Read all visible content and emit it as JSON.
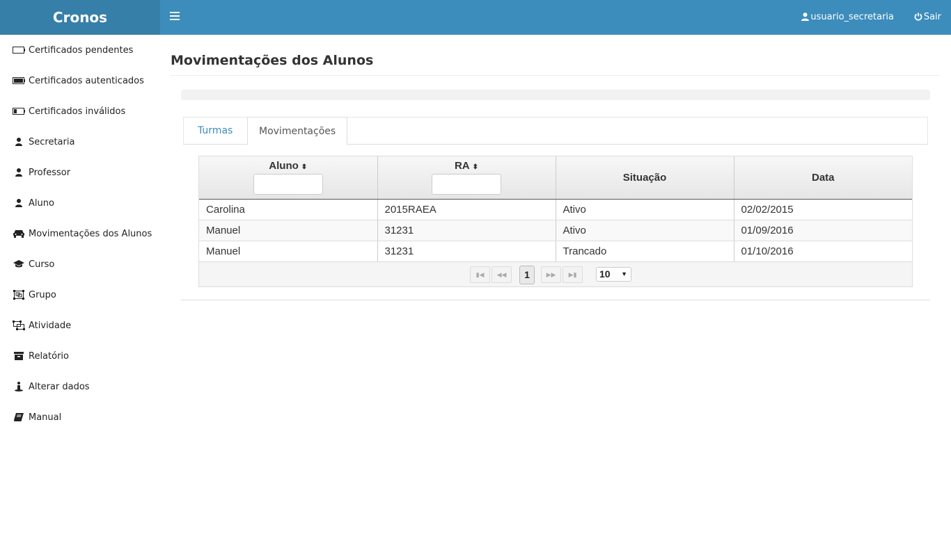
{
  "brand": "Cronos",
  "topbar": {
    "user": "usuario_secretaria",
    "logout": "Sair"
  },
  "sidebar": {
    "items": [
      {
        "label": "Certificados pendentes",
        "icon": "battery-empty-icon"
      },
      {
        "label": "Certificados autenticados",
        "icon": "battery-full-icon"
      },
      {
        "label": "Certificados inválidos",
        "icon": "battery-quarter-icon"
      },
      {
        "label": "Secretaria",
        "icon": "user-icon"
      },
      {
        "label": "Professor",
        "icon": "user-icon"
      },
      {
        "label": "Aluno",
        "icon": "user-icon"
      },
      {
        "label": "Movimentações dos Alunos",
        "icon": "car-icon"
      },
      {
        "label": "Curso",
        "icon": "graduation-cap-icon"
      },
      {
        "label": "Grupo",
        "icon": "object-group-icon"
      },
      {
        "label": "Atividade",
        "icon": "object-ungroup-icon"
      },
      {
        "label": "Relatório",
        "icon": "archive-icon"
      },
      {
        "label": "Alterar dados",
        "icon": "street-view-icon"
      },
      {
        "label": "Manual",
        "icon": "book-icon"
      }
    ]
  },
  "page": {
    "title": "Movimentações dos Alunos"
  },
  "tabs": [
    {
      "label": "Turmas"
    },
    {
      "label": "Movimentações"
    }
  ],
  "table": {
    "columns": [
      "Aluno",
      "RA",
      "Situação",
      "Data"
    ],
    "rows": [
      [
        "Carolina",
        "2015RAEA",
        "Ativo",
        "02/02/2015"
      ],
      [
        "Manuel",
        "31231",
        "Ativo",
        "01/09/2016"
      ],
      [
        "Manuel",
        "31231",
        "Trancado",
        "01/10/2016"
      ]
    ]
  },
  "pager": {
    "current_page": "1",
    "page_size": "10"
  },
  "colors": {
    "topbar": "#3c8dbc",
    "brand": "#367fa9",
    "link": "#3c8dbc"
  }
}
